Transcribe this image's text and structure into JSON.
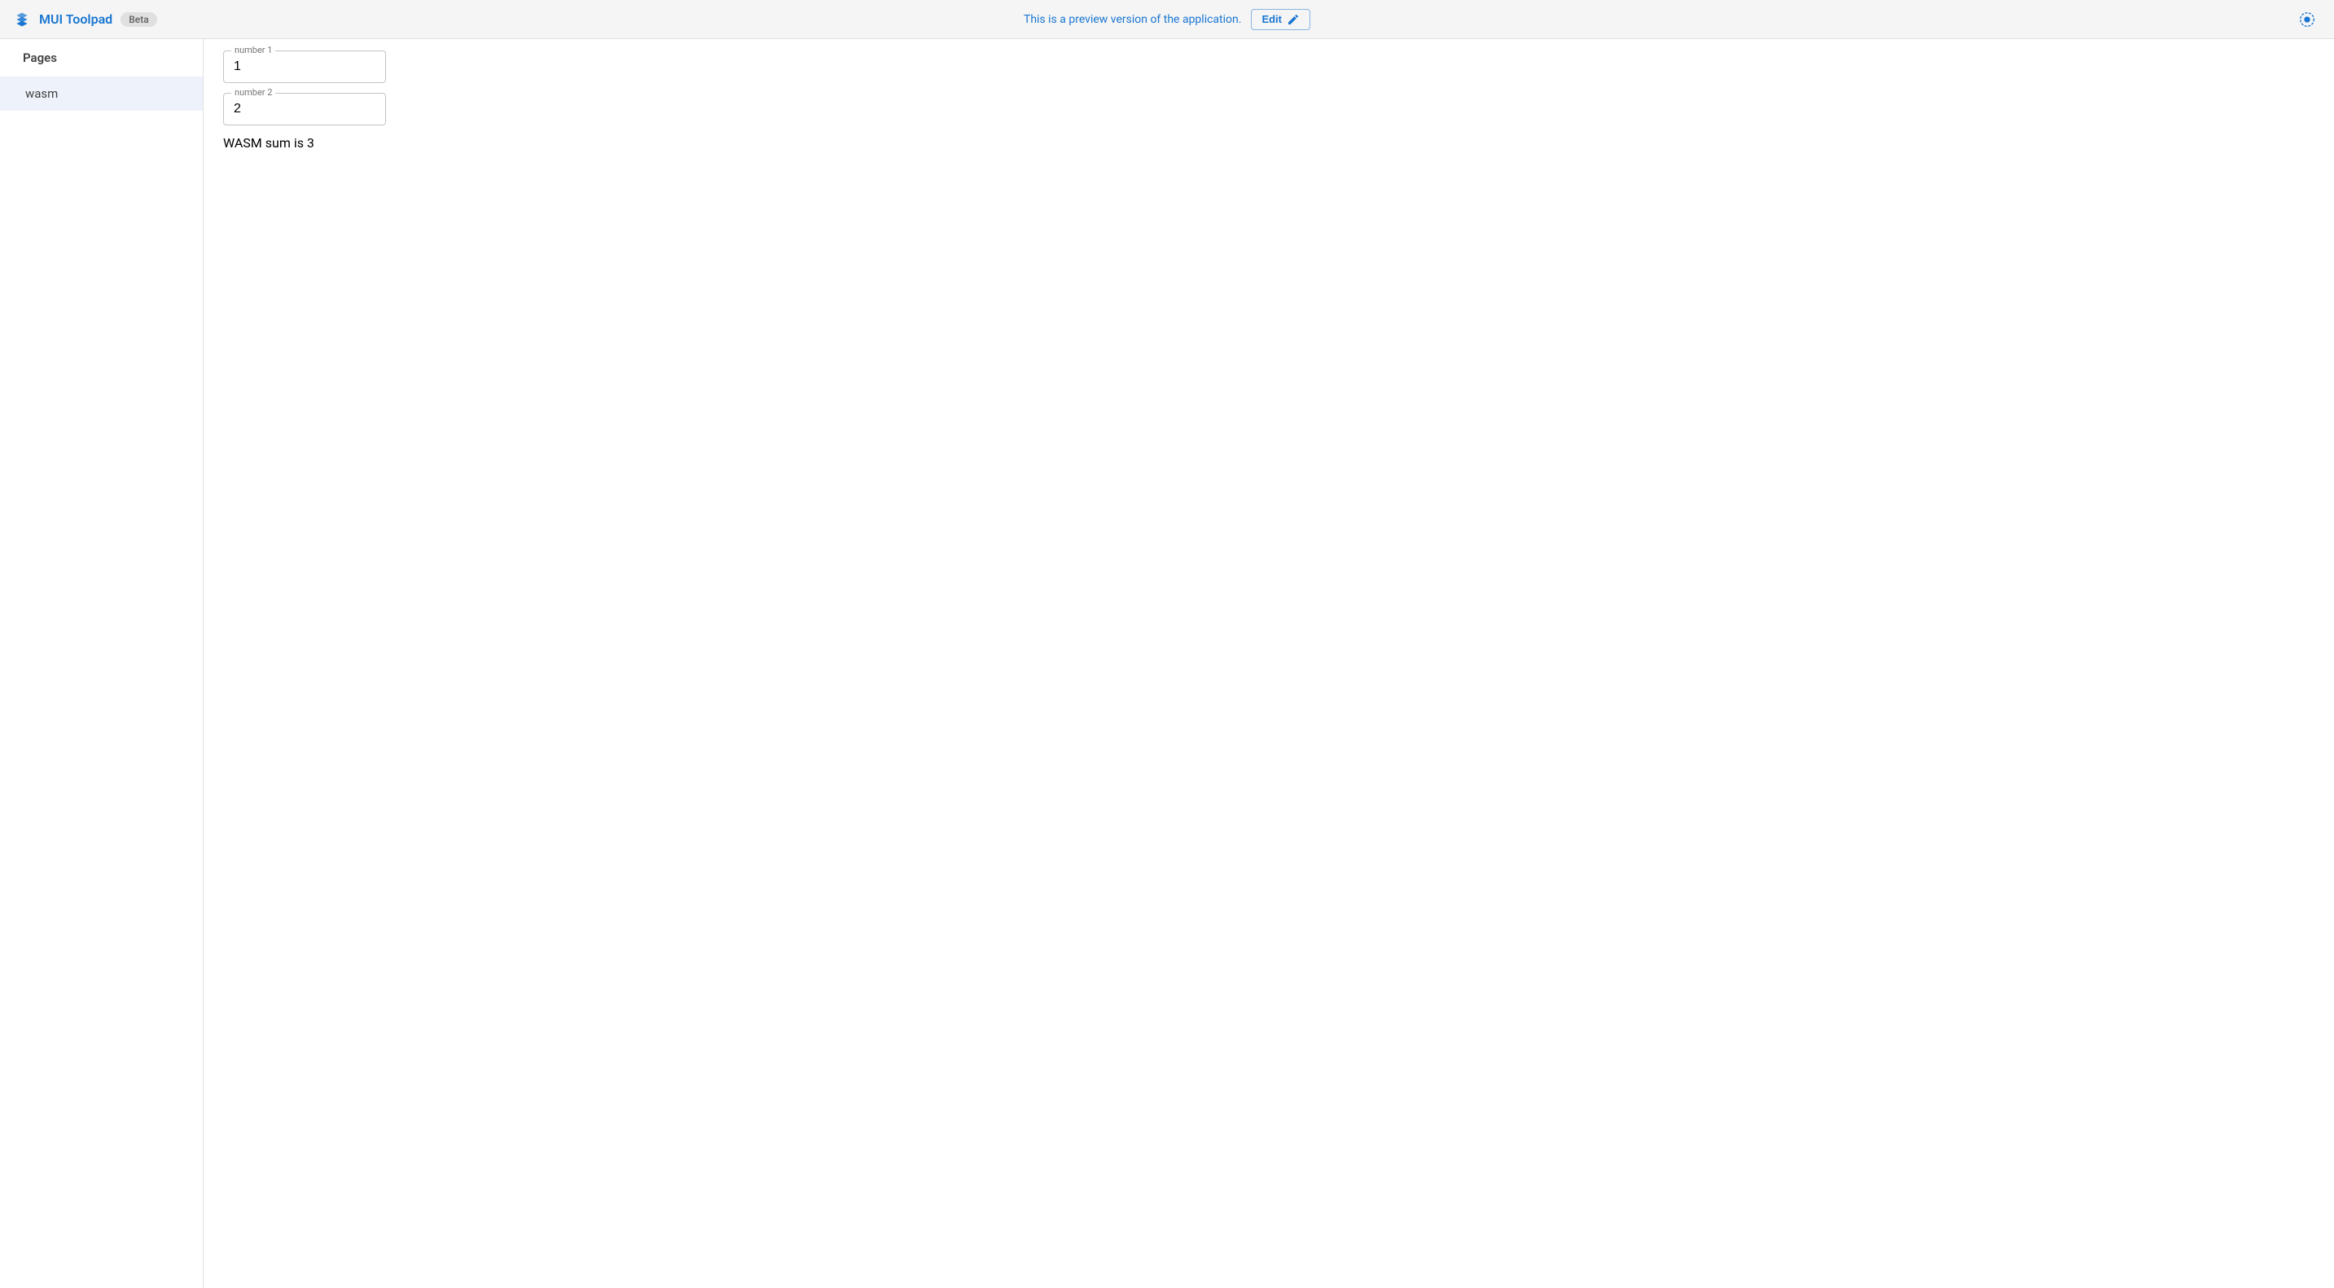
{
  "header": {
    "title": "MUI Toolpad",
    "beta_label": "Beta",
    "preview_message": "This is a preview version of the application.",
    "edit_label": "Edit"
  },
  "sidebar": {
    "section_title": "Pages",
    "items": [
      {
        "label": "wasm",
        "active": true
      }
    ]
  },
  "main": {
    "fields": [
      {
        "label": "number 1",
        "value": "1"
      },
      {
        "label": "number 2",
        "value": "2"
      }
    ],
    "result_text": "WASM sum is 3"
  },
  "icons": {
    "logo": "toolpad-logo",
    "edit": "pencil-icon",
    "theme": "sun-icon"
  },
  "colors": {
    "primary": "#1976d2",
    "header_bg": "#f5f5f5",
    "border": "#e0e0e0",
    "sidebar_active": "#eef2fa"
  }
}
